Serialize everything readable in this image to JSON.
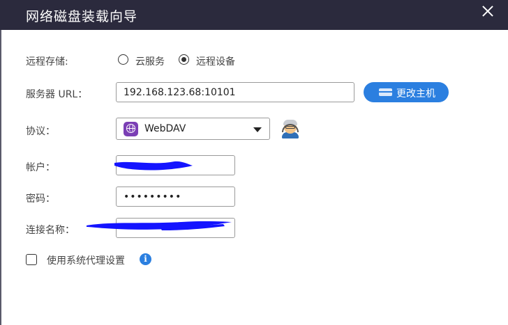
{
  "dialog": {
    "title": "网络磁盘装载向导"
  },
  "remote_storage": {
    "label": "远程存储:",
    "options": [
      {
        "label": "云服务",
        "checked": false
      },
      {
        "label": "远程设备",
        "checked": true
      }
    ]
  },
  "server_url": {
    "label": "服务器 URL：",
    "value": "192.168.123.68:10101",
    "button_label": "更改主机"
  },
  "protocol": {
    "label": "协议：",
    "selected": "WebDAV"
  },
  "account": {
    "label": "帐户："
  },
  "password": {
    "label": "密码：",
    "value": "•••••••••"
  },
  "connection_name": {
    "label": "连接名称："
  },
  "proxy": {
    "label": "使用系统代理设置",
    "checked": false
  },
  "icons": {
    "close": "close-icon",
    "host": "host-icon",
    "webdav": "webdav-logo-icon",
    "helper": "helper-avatar-icon",
    "info": "info-icon"
  },
  "colors": {
    "titlebar": "#2b2a3d",
    "accent": "#2b7fe0",
    "redaction": "#1414ff",
    "webdav": "#7b3fb5"
  }
}
